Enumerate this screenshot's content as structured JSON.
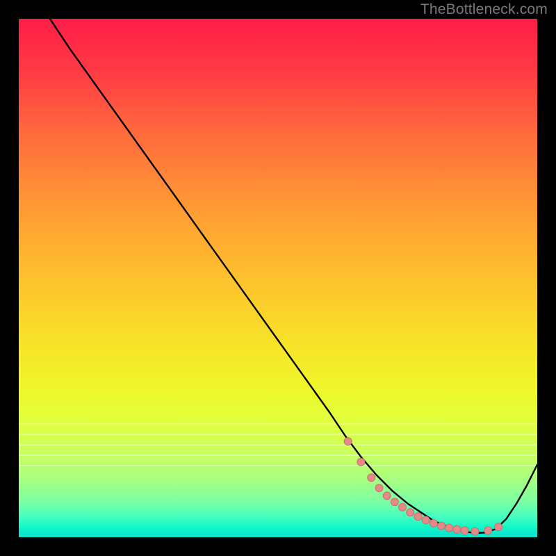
{
  "watermark": "TheBottleneck.com",
  "colors": {
    "page_bg": "#000000",
    "curve": "#000000",
    "dot_fill": "#e68a89",
    "dot_stroke": "#c86f6e"
  },
  "chart_data": {
    "type": "line",
    "title": "",
    "xlabel": "",
    "ylabel": "",
    "xlim": [
      0,
      100
    ],
    "ylim": [
      0,
      100
    ],
    "grid": false,
    "legend": false,
    "series": [
      {
        "name": "bottleneck-curve",
        "x": [
          6,
          10,
          15,
          20,
          25,
          30,
          35,
          40,
          45,
          50,
          55,
          60,
          63,
          66,
          69,
          72,
          75,
          78,
          80,
          82,
          84,
          86,
          88,
          90,
          92,
          94,
          96,
          98,
          100
        ],
        "y": [
          100,
          94,
          87,
          80,
          73,
          66,
          59,
          52,
          45,
          38,
          31,
          24,
          19.5,
          15.5,
          12,
          9,
          6.5,
          4.5,
          3.2,
          2.3,
          1.6,
          1.1,
          0.8,
          0.9,
          1.6,
          3.5,
          6.5,
          10,
          14
        ]
      }
    ],
    "dots": {
      "name": "highlight-points",
      "x": [
        63.5,
        66,
        68,
        69.5,
        71,
        72.5,
        74,
        75.5,
        77,
        78.5,
        80,
        81.5,
        83,
        84.5,
        86,
        88,
        90.5,
        92.5
      ],
      "y": [
        18.5,
        14.5,
        11.5,
        9.5,
        8,
        6.8,
        5.8,
        4.8,
        4.0,
        3.3,
        2.7,
        2.2,
        1.8,
        1.5,
        1.3,
        1.1,
        1.3,
        2.0
      ]
    },
    "bands_y": [
      78,
      80,
      82,
      84,
      86
    ]
  }
}
